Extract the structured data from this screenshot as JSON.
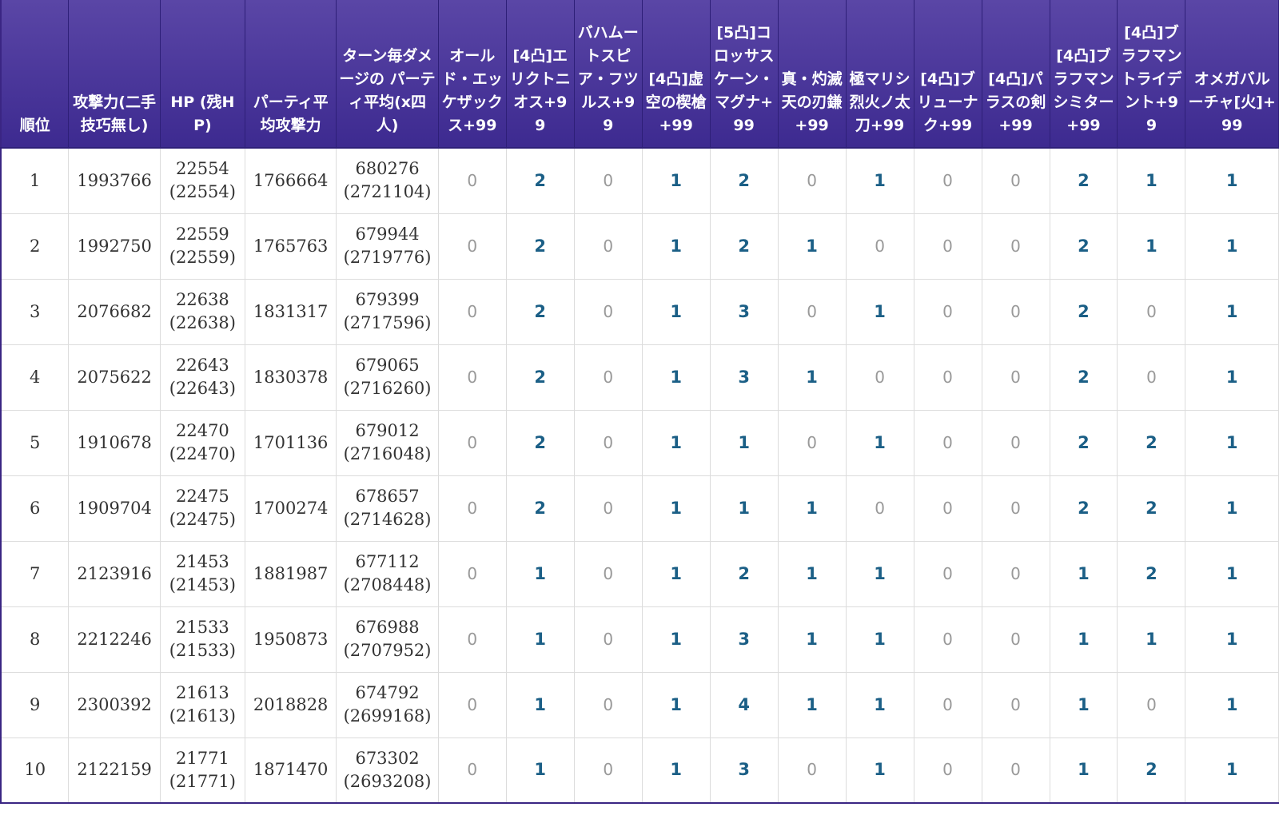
{
  "table": {
    "headers": [
      "順位",
      "攻撃力(二手技巧無し)",
      "HP (残HP)",
      "パーティ平均攻撃力",
      "ターン毎ダメージの パーティ平均(x四人)",
      "オールド・エッケザックス+99",
      "[4凸]エリクトニオス+99",
      "バハムートスピア・フツルス+99",
      "[4凸]虚空の楔槍+99",
      "[5凸]コロッサスケーン・マグナ+99",
      "真・灼滅天の刃鎌+99",
      "極マリシ烈火ノ太刀+99",
      "[4凸]ブリューナク+99",
      "[4凸]パラスの剣+99",
      "[4凸]ブラフマンシミター+99",
      "[4凸]ブラフマントライデント+99",
      "オメガバルーチャ[火]+99"
    ],
    "rows": [
      {
        "rank": "1",
        "attack": "1993766",
        "hp": "22554",
        "hp_rem": "(22554)",
        "party_avg": "1766664",
        "dmg": "680276",
        "dmg_total": "(2721104)",
        "weapons": [
          "0",
          "2",
          "0",
          "1",
          "2",
          "0",
          "1",
          "0",
          "0",
          "2",
          "1",
          "1"
        ]
      },
      {
        "rank": "2",
        "attack": "1992750",
        "hp": "22559",
        "hp_rem": "(22559)",
        "party_avg": "1765763",
        "dmg": "679944",
        "dmg_total": "(2719776)",
        "weapons": [
          "0",
          "2",
          "0",
          "1",
          "2",
          "1",
          "0",
          "0",
          "0",
          "2",
          "1",
          "1"
        ]
      },
      {
        "rank": "3",
        "attack": "2076682",
        "hp": "22638",
        "hp_rem": "(22638)",
        "party_avg": "1831317",
        "dmg": "679399",
        "dmg_total": "(2717596)",
        "weapons": [
          "0",
          "2",
          "0",
          "1",
          "3",
          "0",
          "1",
          "0",
          "0",
          "2",
          "0",
          "1"
        ]
      },
      {
        "rank": "4",
        "attack": "2075622",
        "hp": "22643",
        "hp_rem": "(22643)",
        "party_avg": "1830378",
        "dmg": "679065",
        "dmg_total": "(2716260)",
        "weapons": [
          "0",
          "2",
          "0",
          "1",
          "3",
          "1",
          "0",
          "0",
          "0",
          "2",
          "0",
          "1"
        ]
      },
      {
        "rank": "5",
        "attack": "1910678",
        "hp": "22470",
        "hp_rem": "(22470)",
        "party_avg": "1701136",
        "dmg": "679012",
        "dmg_total": "(2716048)",
        "weapons": [
          "0",
          "2",
          "0",
          "1",
          "1",
          "0",
          "1",
          "0",
          "0",
          "2",
          "2",
          "1"
        ]
      },
      {
        "rank": "6",
        "attack": "1909704",
        "hp": "22475",
        "hp_rem": "(22475)",
        "party_avg": "1700274",
        "dmg": "678657",
        "dmg_total": "(2714628)",
        "weapons": [
          "0",
          "2",
          "0",
          "1",
          "1",
          "1",
          "0",
          "0",
          "0",
          "2",
          "2",
          "1"
        ]
      },
      {
        "rank": "7",
        "attack": "2123916",
        "hp": "21453",
        "hp_rem": "(21453)",
        "party_avg": "1881987",
        "dmg": "677112",
        "dmg_total": "(2708448)",
        "weapons": [
          "0",
          "1",
          "0",
          "1",
          "2",
          "1",
          "1",
          "0",
          "0",
          "1",
          "2",
          "1"
        ]
      },
      {
        "rank": "8",
        "attack": "2212246",
        "hp": "21533",
        "hp_rem": "(21533)",
        "party_avg": "1950873",
        "dmg": "676988",
        "dmg_total": "(2707952)",
        "weapons": [
          "0",
          "1",
          "0",
          "1",
          "3",
          "1",
          "1",
          "0",
          "0",
          "1",
          "1",
          "1"
        ]
      },
      {
        "rank": "9",
        "attack": "2300392",
        "hp": "21613",
        "hp_rem": "(21613)",
        "party_avg": "2018828",
        "dmg": "674792",
        "dmg_total": "(2699168)",
        "weapons": [
          "0",
          "1",
          "0",
          "1",
          "4",
          "1",
          "1",
          "0",
          "0",
          "1",
          "0",
          "1"
        ]
      },
      {
        "rank": "10",
        "attack": "2122159",
        "hp": "21771",
        "hp_rem": "(21771)",
        "party_avg": "1871470",
        "dmg": "673302",
        "dmg_total": "(2693208)",
        "weapons": [
          "0",
          "1",
          "0",
          "1",
          "3",
          "0",
          "1",
          "0",
          "0",
          "1",
          "2",
          "1"
        ]
      }
    ]
  },
  "colors": {
    "header_bg": "#4a3597",
    "header_text": "#ffffff",
    "positive_value": "#1b5f86",
    "zero_value": "#999999"
  }
}
